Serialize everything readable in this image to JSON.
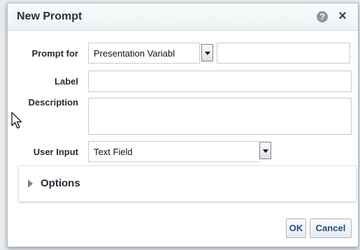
{
  "dialog": {
    "title": "New Prompt",
    "help_icon": "?",
    "close_icon": "×"
  },
  "form": {
    "prompt_for": {
      "label": "Prompt for",
      "selected": "Presentation Variabl",
      "extra_value": ""
    },
    "label_field": {
      "label": "Label",
      "value": ""
    },
    "description": {
      "label": "Description",
      "value": ""
    },
    "user_input": {
      "label": "User Input",
      "selected": "Text Field"
    }
  },
  "options": {
    "label": "Options",
    "expanded": false
  },
  "footer": {
    "ok_label": "OK",
    "cancel_label": "Cancel"
  },
  "icons": {
    "help": "help-icon",
    "close": "close-icon",
    "dropdown": "triangle-down-icon",
    "disclosure": "triangle-right-icon",
    "cursor": "mouse-pointer-icon"
  }
}
